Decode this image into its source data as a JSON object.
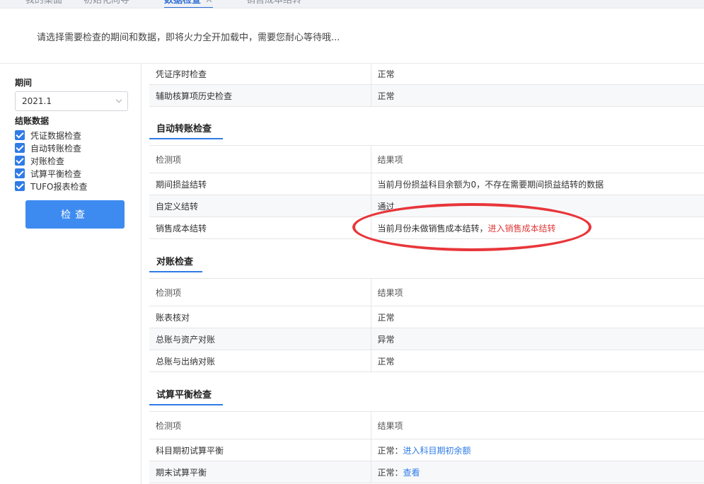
{
  "tabs": [
    {
      "label": "我的桌面",
      "active": false
    },
    {
      "label": "初始化向导",
      "active": false
    },
    {
      "label": "数据检查",
      "active": true
    },
    {
      "label": "销售成本结转",
      "active": false
    }
  ],
  "notice": "请选择需要检查的期间和数据，即将火力全开加载中，需要您耐心等待哦...",
  "sidebar": {
    "period_label": "期间",
    "period_value": "2021.1",
    "data_label": "结账数据",
    "checks": [
      "凭证数据检查",
      "自动转账检查",
      "对账检查",
      "试算平衡检查",
      "TUFO报表检查"
    ],
    "check_button": "检查"
  },
  "voucher": {
    "rows": [
      {
        "item": "凭证序时检查",
        "result": "正常"
      },
      {
        "item": "辅助核算项历史检查",
        "result": "正常"
      }
    ]
  },
  "auto_transfer": {
    "title": "自动转账检查",
    "header": {
      "item": "检测项",
      "result": "结果项"
    },
    "rows": [
      {
        "item": "期间损益结转",
        "result": "当前月份损益科目余额为0，不存在需要期间损益结转的数据"
      },
      {
        "item": "自定义结转",
        "result": "通过"
      },
      {
        "item": "销售成本结转",
        "result": "当前月份未做销售成本结转，",
        "link": "进入销售成本结转"
      }
    ]
  },
  "reconcile": {
    "title": "对账检查",
    "header": {
      "item": "检测项",
      "result": "结果项"
    },
    "rows": [
      {
        "item": "账表核对",
        "result": "正常"
      },
      {
        "item": "总账与资产对账",
        "result": "异常"
      },
      {
        "item": "总账与出纳对账",
        "result": "正常"
      }
    ]
  },
  "trial_balance": {
    "title": "试算平衡检查",
    "header": {
      "item": "检测项",
      "result": "结果项"
    },
    "rows": [
      {
        "item": "科目期初试算平衡",
        "result": "正常：",
        "link": "进入科目期初余额"
      },
      {
        "item": "期末试算平衡",
        "result": "正常：",
        "link": "查看"
      }
    ]
  },
  "colors": {
    "accent": "#2f7ce6",
    "error": "#e03a3a",
    "annotation": "#e8363a"
  }
}
